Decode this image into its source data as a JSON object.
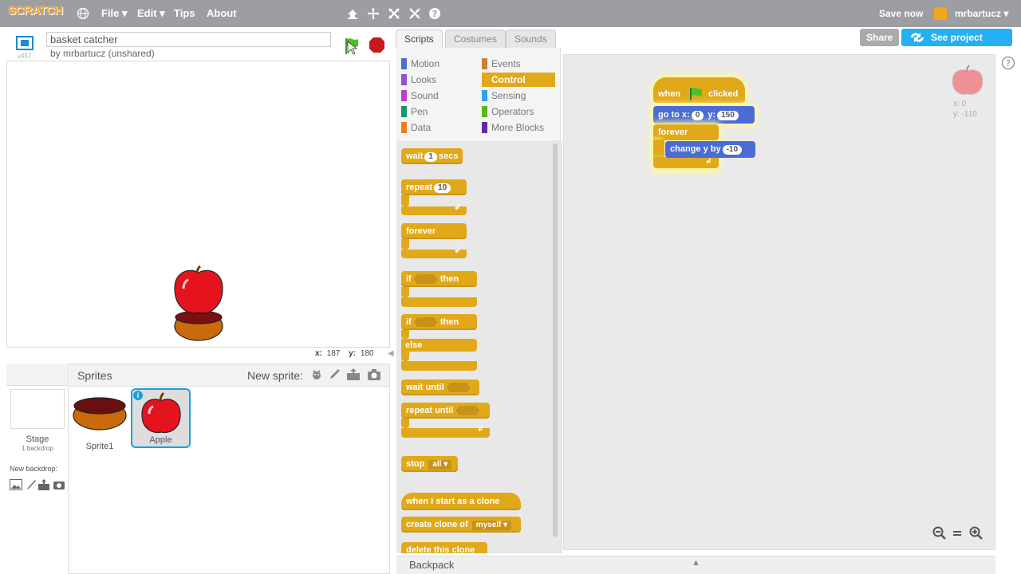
{
  "topbar": {
    "logo": "SCRATCH",
    "menus": [
      "File ▾",
      "Edit ▾",
      "Tips",
      "About"
    ],
    "save_now": "Save now",
    "username": "mrbartucz ▾"
  },
  "project": {
    "title": "basket catcher",
    "by": "by mrbartucz (unshared)",
    "version": "v457"
  },
  "stage": {
    "coords_x_label": "x:",
    "coords_x": "187",
    "coords_y_label": "y:",
    "coords_y": "180"
  },
  "tabs": [
    "Scripts",
    "Costumes",
    "Sounds"
  ],
  "buttons": {
    "share": "Share",
    "see_project": "See project page"
  },
  "categories": {
    "left": [
      {
        "label": "Motion",
        "color": "#4a6cd4"
      },
      {
        "label": "Looks",
        "color": "#8a55d7"
      },
      {
        "label": "Sound",
        "color": "#bb42c3"
      },
      {
        "label": "Pen",
        "color": "#0e9a6c"
      },
      {
        "label": "Data",
        "color": "#ee7d16"
      }
    ],
    "right": [
      {
        "label": "Events",
        "color": "#c88330"
      },
      {
        "label": "Control",
        "color": "#e1a91a"
      },
      {
        "label": "Sensing",
        "color": "#2ca5e2"
      },
      {
        "label": "Operators",
        "color": "#5cb712"
      },
      {
        "label": "More Blocks",
        "color": "#632d99"
      }
    ]
  },
  "palette": {
    "wait": "wait",
    "wait_val": "1",
    "wait_secs": "secs",
    "repeat": "repeat",
    "repeat_val": "10",
    "forever": "forever",
    "if": "if",
    "then": "then",
    "if2": "if",
    "then2": "then",
    "else": "else",
    "wait_until": "wait until",
    "repeat_until": "repeat until",
    "stop": "stop",
    "stop_val": "all ▾",
    "when_clone": "when I start as a clone",
    "create_clone": "create clone of",
    "create_clone_val": "myself ▾",
    "delete_clone": "delete this clone"
  },
  "script": {
    "when": "when",
    "clicked": "clicked",
    "goto": "go to x:",
    "goto_x": "0",
    "goto_y_label": "y:",
    "goto_y": "150",
    "forever": "forever",
    "change_y": "change y by",
    "change_val": "-10"
  },
  "sprite_info": {
    "x": "x: 0",
    "y": "y: -110"
  },
  "sprites_pane": {
    "header": "Sprites",
    "new_sprite": "New sprite:",
    "stage_label": "Stage",
    "stage_sub": "1 backdrop",
    "new_backdrop": "New backdrop:",
    "sprites": [
      {
        "name": "Sprite1"
      },
      {
        "name": "Apple"
      }
    ]
  },
  "backpack": "Backpack",
  "colors": {
    "topbar": "#9c9ea2",
    "control": "#e1a91a",
    "motion": "#4a6cd4",
    "share": "#aaaaaa",
    "see_project": "#25aff4",
    "selected_sprite_border": "#1aa0d8"
  }
}
